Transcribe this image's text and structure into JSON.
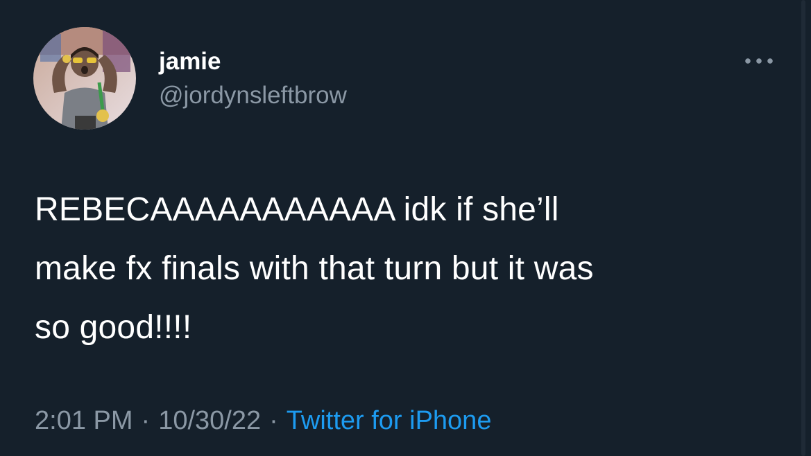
{
  "author": {
    "display_name": "jamie",
    "handle": "@jordynsleftbrow"
  },
  "tweet": {
    "text": "REBECAAAAAAAAAAA idk if she’ll\nmake fx finals with that turn but it was\nso good!!!!"
  },
  "meta": {
    "time": "2:01 PM",
    "date": "10/30/22",
    "separator": "·",
    "source": "Twitter for iPhone"
  },
  "icons": {
    "more": "more-horizontal-icon",
    "avatar": "profile-photo"
  },
  "colors": {
    "background": "#15202b",
    "primary_text": "#ffffff",
    "secondary_text": "#8b98a5",
    "link": "#1d9bf0"
  }
}
